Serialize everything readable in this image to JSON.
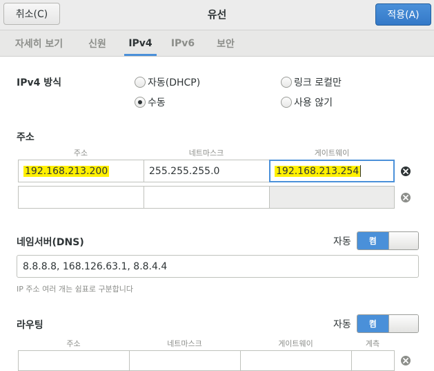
{
  "header": {
    "cancel_label": "취소(C)",
    "title": "유선",
    "apply_label": "적용(A)"
  },
  "tabs": [
    {
      "label": "자세히 보기",
      "active": false
    },
    {
      "label": "신원",
      "active": false
    },
    {
      "label": "IPv4",
      "active": true
    },
    {
      "label": "IPv6",
      "active": false
    },
    {
      "label": "보안",
      "active": false
    }
  ],
  "method": {
    "label": "IPv4 방식",
    "options": [
      {
        "label": "자동(DHCP)",
        "checked": false
      },
      {
        "label": "링크 로컬만",
        "checked": false
      },
      {
        "label": "수동",
        "checked": true
      },
      {
        "label": "사용 않기",
        "checked": false
      }
    ]
  },
  "addresses": {
    "section_label": "주소",
    "columns": [
      "주소",
      "네트마스크",
      "게이트웨이"
    ],
    "rows": [
      {
        "address": "192.168.213.200",
        "netmask": "255.255.255.0",
        "gateway": "192.168.213.254"
      },
      {
        "address": "",
        "netmask": "",
        "gateway": ""
      }
    ]
  },
  "dns": {
    "section_label": "네임서버(DNS)",
    "auto_label": "자동",
    "switch_on_label": "켬",
    "value": "8.8.8.8, 168.126.63.1, 8.8.4.4",
    "hint": "IP 주소 여러 개는 쉼표로 구분합니다"
  },
  "routing": {
    "section_label": "라우팅",
    "auto_label": "자동",
    "switch_on_label": "켬",
    "columns": [
      "주소",
      "네트마스크",
      "게이트웨이",
      "계측"
    ]
  },
  "colors": {
    "accent": "#4a90d9",
    "highlight": "#fff000"
  }
}
